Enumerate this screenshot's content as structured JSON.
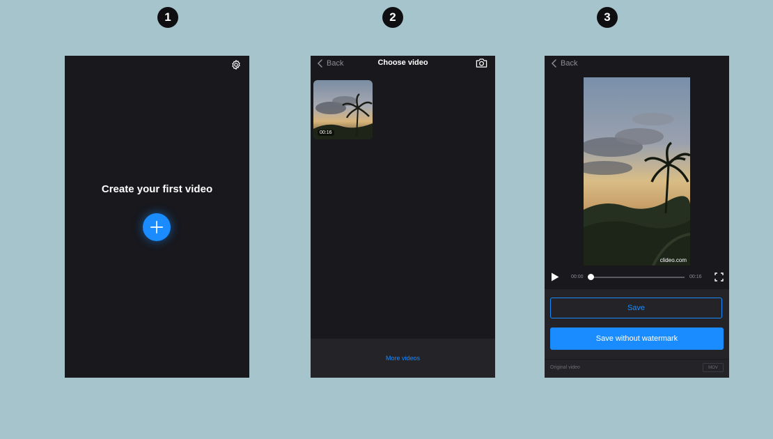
{
  "steps": [
    "1",
    "2",
    "3"
  ],
  "screen1": {
    "title": "Create your first video",
    "settings_icon": "gear-icon",
    "add_icon": "plus-icon"
  },
  "screen2": {
    "back_label": "Back",
    "title": "Choose video",
    "camera_icon": "camera-icon",
    "thumbnail": {
      "duration": "00:16"
    },
    "more_videos_label": "More videos"
  },
  "screen3": {
    "back_label": "Back",
    "watermark": "clideo.com",
    "player": {
      "current_time": "00:00",
      "total_time": "00:16",
      "progress": 0
    },
    "save_label": "Save",
    "save_without_watermark_label": "Save without watermark",
    "original_video_label": "Original video",
    "format": "MOV"
  },
  "colors": {
    "background": "#a5c4cb",
    "screen": "#18181d",
    "accent": "#1a8cff"
  }
}
